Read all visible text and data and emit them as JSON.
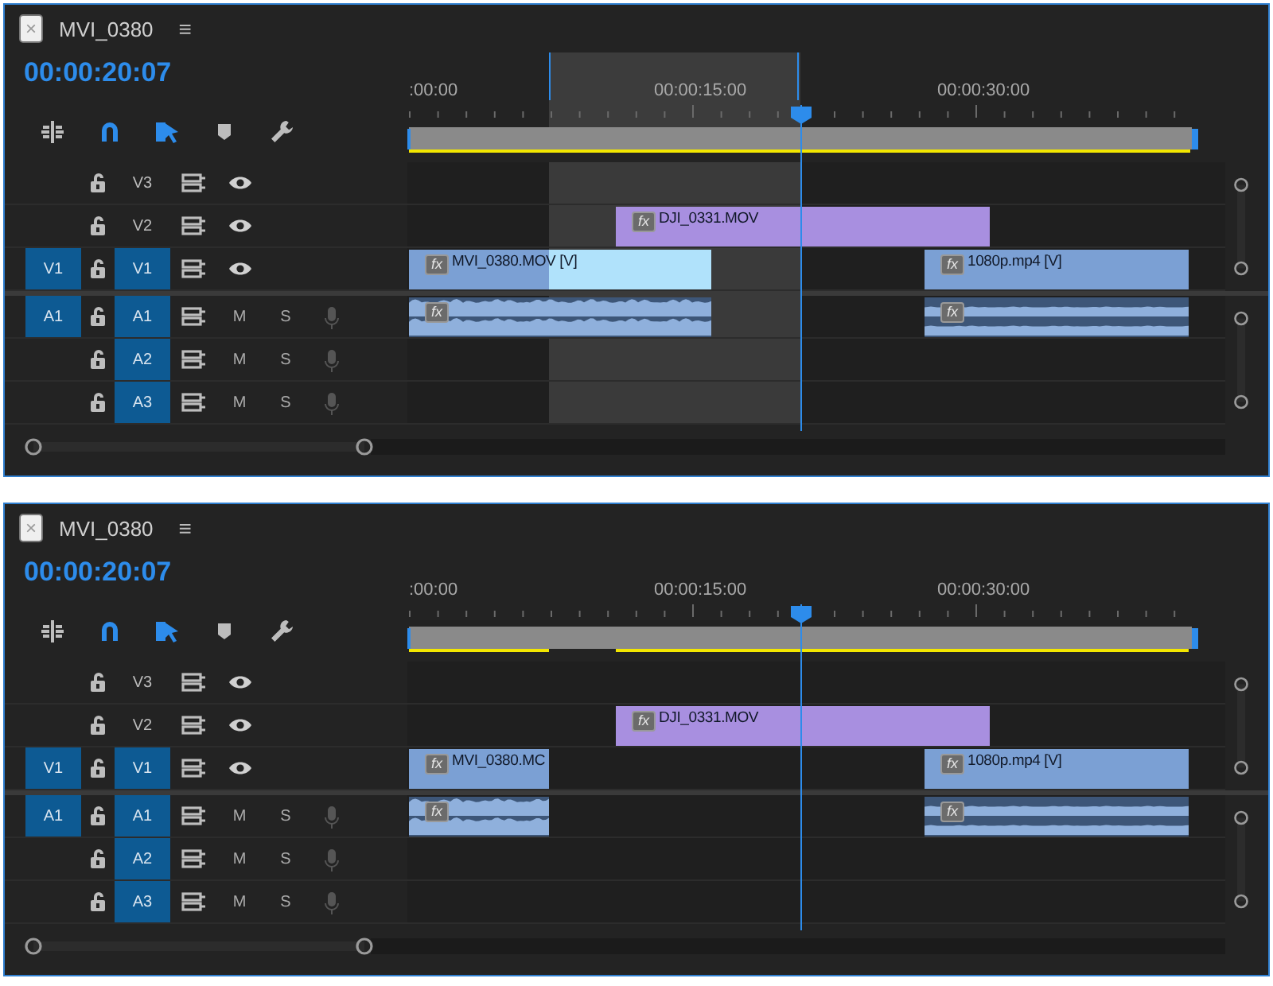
{
  "panels": [
    {
      "close": "×",
      "title": "MVI_0380",
      "menu": "≡",
      "timecode": "00:00:20:07",
      "in_out_range": true,
      "toolbar": [
        {
          "kind": "nest",
          "on": false
        },
        {
          "kind": "snap",
          "on": true
        },
        {
          "kind": "linked",
          "on": true
        },
        {
          "kind": "marker",
          "on": false
        },
        {
          "kind": "settings",
          "on": false
        }
      ],
      "ruler": [
        ":00:00",
        "00:00:15:00",
        "00:00:30:00"
      ],
      "tracks": [
        {
          "kind": "video",
          "label": "V3",
          "targeted": false
        },
        {
          "kind": "video",
          "label": "V2",
          "targeted": false,
          "clips": [
            {
              "name": "DJI_0331.MOV",
              "badge": "fx",
              "color": "#a88fe0"
            }
          ]
        },
        {
          "kind": "video",
          "source": "V1",
          "label": "V1",
          "targeted": true,
          "clips": [
            {
              "name": "MVI_0380.MOV [V]",
              "badge": "fx",
              "color": "#7ba0d4"
            },
            {
              "name": "1080p.mp4 [V]",
              "badge": "fx",
              "color": "#7ba0d4"
            }
          ]
        },
        {
          "kind": "audio",
          "source": "A1",
          "label": "A1",
          "targeted": true,
          "mute": "M",
          "solo": "S",
          "clips": [
            {
              "badge": "fx",
              "color": "#7ba0d4"
            },
            {
              "badge": "fx",
              "color": "#7ba0d4"
            }
          ]
        },
        {
          "kind": "audio",
          "label": "A2",
          "targeted": true,
          "mute": "M",
          "solo": "S"
        },
        {
          "kind": "audio",
          "label": "A3",
          "targeted": true,
          "mute": "M",
          "solo": "S"
        }
      ]
    },
    {
      "close": "×",
      "title": "MVI_0380",
      "menu": "≡",
      "timecode": "00:00:20:07",
      "in_out_range": false,
      "toolbar": [
        {
          "kind": "nest",
          "on": false
        },
        {
          "kind": "snap",
          "on": true
        },
        {
          "kind": "linked",
          "on": true
        },
        {
          "kind": "marker",
          "on": false
        },
        {
          "kind": "settings",
          "on": false
        }
      ],
      "ruler": [
        ":00:00",
        "00:00:15:00",
        "00:00:30:00"
      ],
      "tracks": [
        {
          "kind": "video",
          "label": "V3",
          "targeted": false
        },
        {
          "kind": "video",
          "label": "V2",
          "targeted": false,
          "clips": [
            {
              "name": "DJI_0331.MOV",
              "badge": "fx",
              "color": "#a88fe0"
            }
          ]
        },
        {
          "kind": "video",
          "source": "V1",
          "label": "V1",
          "targeted": true,
          "clips": [
            {
              "name": "MVI_0380.MC",
              "badge": "fx",
              "color": "#7ba0d4"
            },
            {
              "name": "1080p.mp4 [V]",
              "badge": "fx",
              "color": "#7ba0d4"
            }
          ]
        },
        {
          "kind": "audio",
          "source": "A1",
          "label": "A1",
          "targeted": true,
          "mute": "M",
          "solo": "S",
          "clips": [
            {
              "badge": "fx",
              "color": "#7ba0d4"
            },
            {
              "badge": "fx",
              "color": "#7ba0d4"
            }
          ]
        },
        {
          "kind": "audio",
          "label": "A2",
          "targeted": true,
          "mute": "M",
          "solo": "S"
        },
        {
          "kind": "audio",
          "label": "A3",
          "targeted": true,
          "mute": "M",
          "solo": "S"
        }
      ]
    }
  ]
}
